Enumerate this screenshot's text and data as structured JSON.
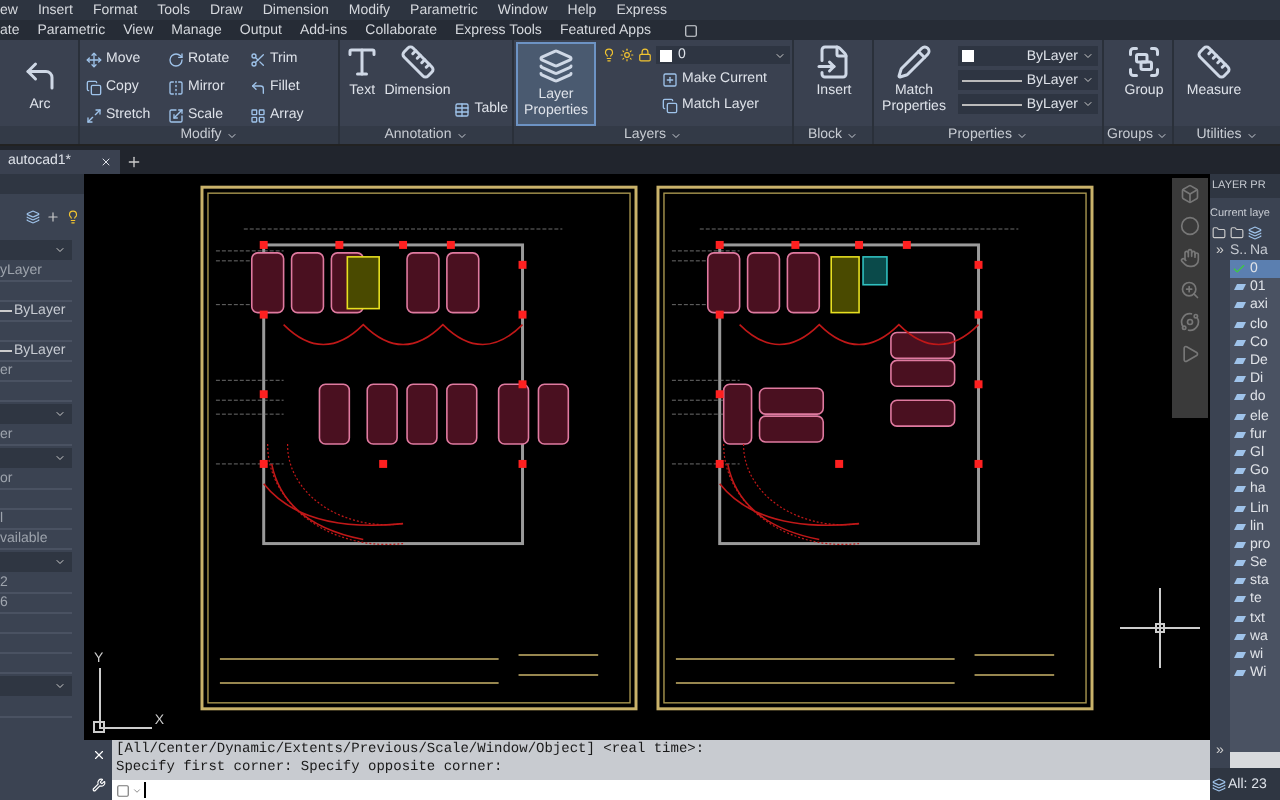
{
  "menu_bar": [
    "ew",
    "Insert",
    "Format",
    "Tools",
    "Draw",
    "Dimension",
    "Modify",
    "Parametric",
    "Window",
    "Help",
    "Express"
  ],
  "ribbon_tabs": [
    "ate",
    "Parametric",
    "View",
    "Manage",
    "Output",
    "Add-ins",
    "Collaborate",
    "Express Tools",
    "Featured Apps"
  ],
  "ribbon": {
    "draw_panel": {
      "tool": "Arc"
    },
    "modify_panel": {
      "title": "Modify",
      "tools": [
        "Move",
        "Rotate",
        "Trim",
        "Copy",
        "Mirror",
        "Fillet",
        "Stretch",
        "Scale",
        "Array"
      ]
    },
    "annotation_panel": {
      "title": "Annotation",
      "tools": [
        "Text",
        "Dimension",
        "Table"
      ]
    },
    "layers_panel": {
      "title": "Layers",
      "button": "Layer Properties",
      "layer_dropdown": "0",
      "tools": [
        "Make Current",
        "Match Layer"
      ]
    },
    "block_panel": {
      "title": "Block",
      "tool": "Insert"
    },
    "properties_panel": {
      "title": "Properties",
      "button": "Match Properties",
      "dropdowns": [
        "ByLayer",
        "ByLayer",
        "ByLayer"
      ]
    },
    "groups_panel": {
      "title": "Groups",
      "tool": "Group"
    },
    "utilities_panel": {
      "title": "Utilities",
      "tool": "Measure"
    }
  },
  "file_tabs": [
    {
      "label": "autocad1*",
      "selected": true
    }
  ],
  "properties_palette": [
    {
      "kind": "header"
    },
    {
      "kind": "text",
      "text": "yLayer"
    },
    {
      "kind": "empty"
    },
    {
      "kind": "line",
      "text": "ByLayer"
    },
    {
      "kind": "empty"
    },
    {
      "kind": "line",
      "text": "ByLayer"
    },
    {
      "kind": "text",
      "text": "er"
    },
    {
      "kind": "empty"
    },
    {
      "kind": "header"
    },
    {
      "kind": "text",
      "text": "er"
    },
    {
      "kind": "header"
    },
    {
      "kind": "text",
      "text": "or"
    },
    {
      "kind": "empty"
    },
    {
      "kind": "text",
      "text": "l"
    },
    {
      "kind": "text",
      "text": "vailable"
    },
    {
      "kind": "header"
    },
    {
      "kind": "text",
      "text": "2"
    },
    {
      "kind": "text",
      "text": "6"
    },
    {
      "kind": "empty"
    },
    {
      "kind": "empty"
    },
    {
      "kind": "empty"
    },
    {
      "kind": "header"
    },
    {
      "kind": "empty"
    }
  ],
  "canvas": {
    "ucs": {
      "x_label": "X",
      "y_label": "Y"
    }
  },
  "command_line": {
    "history": [
      "[All/Center/Dynamic/Extents/Previous/Scale/Window/Object] <real time>:",
      "Specify first corner: Specify opposite corner:"
    ]
  },
  "layer_palette": {
    "title": "LAYER PR",
    "current_layer": "Current laye",
    "expand": "»",
    "columns": [
      "S..",
      "Na"
    ],
    "layers": [
      {
        "name": "0",
        "current": true,
        "selected": true
      },
      {
        "name": "01",
        "current": false,
        "selected": false
      },
      {
        "name": "axi",
        "current": false,
        "selected": false
      },
      {
        "name": "clo",
        "current": false,
        "selected": false
      },
      {
        "name": "Co",
        "current": false,
        "selected": false
      },
      {
        "name": "De",
        "current": false,
        "selected": false
      },
      {
        "name": "Di",
        "current": false,
        "selected": false
      },
      {
        "name": "do",
        "current": false,
        "selected": false
      },
      {
        "name": "ele",
        "current": false,
        "selected": false
      },
      {
        "name": "fur",
        "current": false,
        "selected": false
      },
      {
        "name": "Gl",
        "current": false,
        "selected": false
      },
      {
        "name": "Go",
        "current": false,
        "selected": false
      },
      {
        "name": "ha",
        "current": false,
        "selected": false
      },
      {
        "name": "Lin",
        "current": false,
        "selected": false
      },
      {
        "name": "lin",
        "current": false,
        "selected": false
      },
      {
        "name": "pro",
        "current": false,
        "selected": false
      },
      {
        "name": "Se",
        "current": false,
        "selected": false
      },
      {
        "name": "sta",
        "current": false,
        "selected": false
      },
      {
        "name": "te",
        "current": false,
        "selected": false
      },
      {
        "name": "txt",
        "current": false,
        "selected": false
      },
      {
        "name": "wa",
        "current": false,
        "selected": false
      },
      {
        "name": "wi",
        "current": false,
        "selected": false
      },
      {
        "name": "Wi",
        "current": false,
        "selected": false
      }
    ],
    "bottom_expand": "»",
    "status": "All: 23"
  }
}
